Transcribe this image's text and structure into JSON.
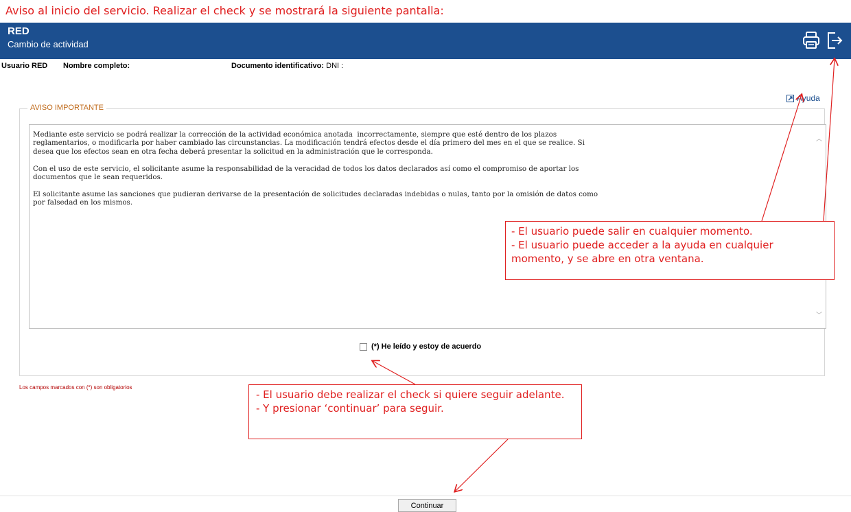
{
  "caption": "Aviso al inicio del servicio. Realizar el check y se mostrará la siguiente pantalla:",
  "header": {
    "app": "RED",
    "subtitle": "Cambio de actividad",
    "icons": [
      "printer-icon",
      "exit-icon"
    ]
  },
  "user": {
    "label_user": "Usuario RED",
    "label_name": "Nombre completo:",
    "label_doc": "Documento identificativo:",
    "doc_value": "DNI :"
  },
  "help_label": "Ayuda",
  "notice": {
    "legend": "AVISO IMPORTANTE",
    "text": "Mediante este servicio se podrá realizar la corrección de la actividad económica anotada  incorrectamente, siempre que esté dentro de los plazos\nreglamentarios, o modificarla por haber cambiado las circunstancias. La modificación tendrá efectos desde el día primero del mes en el que se realice. Si\ndesea que los efectos sean en otra fecha deberá presentar la solicitud en la administración que le corresponda.\n\nCon el uso de este servicio, el solicitante asume la responsabilidad de la veracidad de todos los datos declarados así como el compromiso de aportar los\ndocumentos que le sean requeridos.\n\nEl solicitante asume las sanciones que pudieran derivarse de la presentación de solicitudes declaradas indebidas o nulas, tanto por la omisión de datos como\npor falsedad en los mismos."
  },
  "agree_label": "(*) He leído y estoy de acuerdo",
  "required_note": "Los campos marcados con (*) son obligatorios",
  "callout_top": {
    "line1": "- El usuario puede salir en cualquier momento.",
    "line2": "- El usuario puede acceder a la ayuda en cualquier momento, y se abre en otra ventana."
  },
  "callout_bottom": {
    "line1": "-  El usuario debe realizar el check si quiere seguir adelante.",
    "line2": "-  Y presionar ‘continuar’ para seguir."
  },
  "continue_label": "Continuar",
  "colors": {
    "header_bg": "#1c4f8f",
    "annotation": "#e02020",
    "legend": "#c06a1a"
  }
}
